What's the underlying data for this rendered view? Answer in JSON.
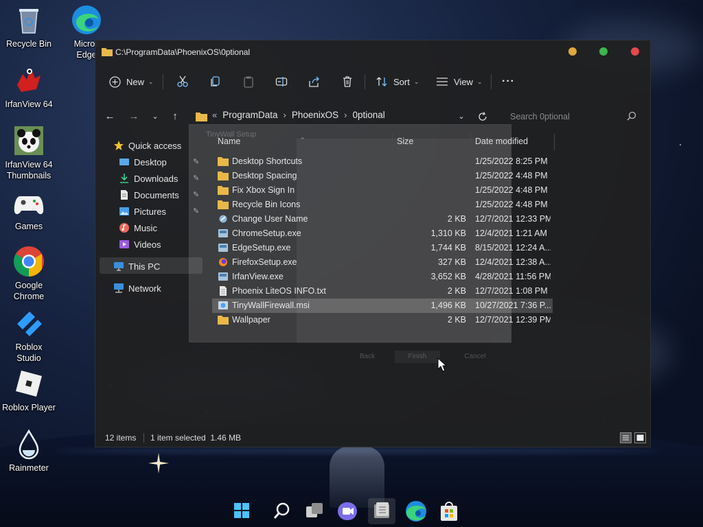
{
  "desktop": {
    "icons": [
      {
        "label": "Recycle Bin"
      },
      {
        "label": "Micros\nEdge"
      },
      {
        "label": "IrfanView 64"
      },
      {
        "label": "IrfanView 64\nThumbnails"
      },
      {
        "label": "Games"
      },
      {
        "label": "Google\nChrome"
      },
      {
        "label": "Roblox\nStudio"
      },
      {
        "label": "Roblox Player"
      },
      {
        "label": "Rainmeter"
      }
    ]
  },
  "window": {
    "title": "C:\\ProgramData\\PhoenixOS\\0ptional",
    "toolbar": {
      "new_label": "New",
      "sort_label": "Sort",
      "view_label": "View",
      "more_label": "···"
    },
    "address": {
      "overflow": "«",
      "crumbs": [
        "ProgramData",
        "PhoenixOS",
        "0ptional"
      ],
      "search_placeholder": "Search 0ptional"
    },
    "sidebar": {
      "items": [
        {
          "label": "Quick access",
          "icon": "star-icon"
        },
        {
          "label": "Desktop",
          "icon": "desktop-folder-icon",
          "pinned": true
        },
        {
          "label": "Downloads",
          "icon": "downloads-icon",
          "pinned": true
        },
        {
          "label": "Documents",
          "icon": "documents-icon",
          "pinned": true
        },
        {
          "label": "Pictures",
          "icon": "pictures-icon",
          "pinned": true
        },
        {
          "label": "Music",
          "icon": "music-icon"
        },
        {
          "label": "Videos",
          "icon": "videos-icon"
        },
        {
          "label": "This PC",
          "icon": "this-pc-icon"
        },
        {
          "label": "Network",
          "icon": "network-icon"
        }
      ],
      "pin_glyph": "📌"
    },
    "columns": {
      "name": "Name",
      "size": "Size",
      "date": "Date modified"
    },
    "files": [
      {
        "name": "Desktop Shortcuts",
        "size": "",
        "date": "1/25/2022 8:25 PM",
        "type": "folder"
      },
      {
        "name": "Desktop Spacing",
        "size": "",
        "date": "1/25/2022 4:48 PM",
        "type": "folder"
      },
      {
        "name": "Fix Xbox Sign In",
        "size": "",
        "date": "1/25/2022 4:48 PM",
        "type": "folder"
      },
      {
        "name": "Recycle Bin Icons",
        "size": "",
        "date": "1/25/2022 4:48 PM",
        "type": "folder"
      },
      {
        "name": "Change User Name",
        "size": "2 KB",
        "date": "12/7/2021 12:33 PM",
        "type": "shortcut"
      },
      {
        "name": "ChromeSetup.exe",
        "size": "1,310 KB",
        "date": "12/4/2021 1:21 AM",
        "type": "exe"
      },
      {
        "name": "EdgeSetup.exe",
        "size": "1,744 KB",
        "date": "8/15/2021 12:24 A...",
        "type": "exe"
      },
      {
        "name": "FirefoxSetup.exe",
        "size": "327 KB",
        "date": "12/4/2021 12:38 A...",
        "type": "firefox"
      },
      {
        "name": "IrfanView.exe",
        "size": "3,652 KB",
        "date": "4/28/2021 11:56 PM",
        "type": "exe"
      },
      {
        "name": "Phoenix LiteOS INFO.txt",
        "size": "2 KB",
        "date": "12/7/2021 1:08 PM",
        "type": "text"
      },
      {
        "name": "TinyWallFirewall.msi",
        "size": "1,496 KB",
        "date": "10/27/2021 7:36 P...",
        "type": "msi",
        "selected": true
      },
      {
        "name": "Wallpaper",
        "size": "2 KB",
        "date": "12/7/2021 12:39 PM",
        "type": "folder"
      }
    ],
    "status": {
      "count": "12 items",
      "selection": "1 item selected  1.46 MB"
    }
  },
  "background_dialog": {
    "title": "TinyWall Setup",
    "buttons": [
      "Back",
      "Finish",
      "Cancel"
    ]
  },
  "colors": {
    "folder": "#e8b84a",
    "close": "#e5484d",
    "maximize": "#3cb64c",
    "minimize": "#e0a93a",
    "accent": "#4aa3ff"
  }
}
